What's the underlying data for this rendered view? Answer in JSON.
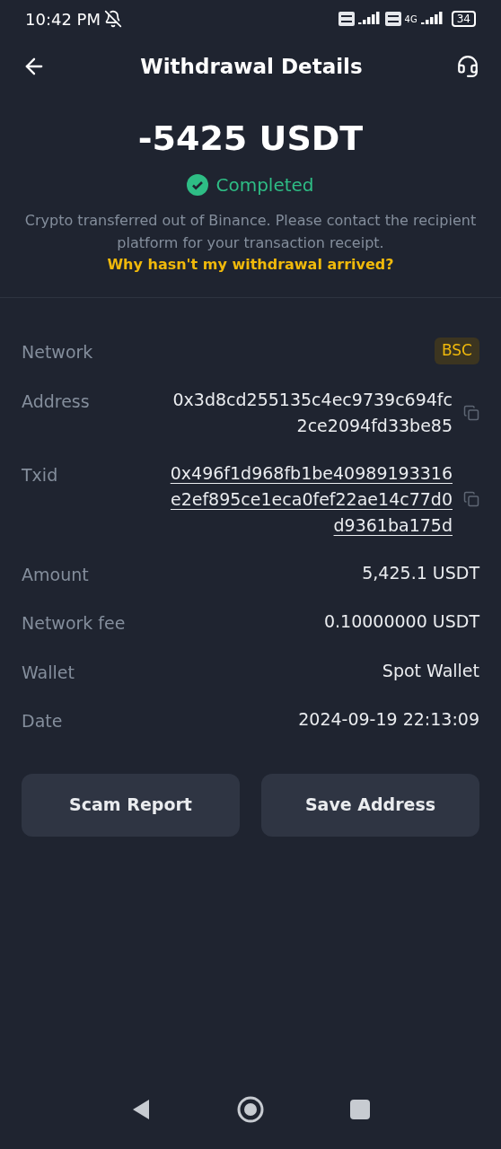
{
  "status_bar": {
    "time": "10:42 PM",
    "network": "4G",
    "battery": "34"
  },
  "header": {
    "title": "Withdrawal Details"
  },
  "summary": {
    "amount": "-5425 USDT",
    "status": "Completed",
    "note": "Crypto transferred out of Binance. Please contact the recipient platform for your transaction receipt.",
    "help_link": "Why hasn't my withdrawal arrived?"
  },
  "details": [
    {
      "kind": "tag",
      "label": "Network",
      "value": "BSC"
    },
    {
      "kind": "copy",
      "label": "Address",
      "lines": [
        "0x3d8cd255135c4ec9739c694fc",
        "2ce2094fd33be85"
      ]
    },
    {
      "kind": "link",
      "label": "Txid",
      "lines": [
        "0x496f1d968fb1be40989193316",
        "e2ef895ce1eca0fef22ae14c77d0",
        "d9361ba175d"
      ]
    },
    {
      "kind": "plain",
      "label": "Amount",
      "value": "5,425.1 USDT"
    },
    {
      "kind": "plain",
      "label": "Network fee",
      "value": "0.10000000 USDT"
    },
    {
      "kind": "plain",
      "label": "Wallet",
      "value": "Spot Wallet"
    },
    {
      "kind": "plain",
      "label": "Date",
      "value": "2024-09-19 22:13:09"
    }
  ],
  "buttons": [
    "Scam Report",
    "Save Address"
  ]
}
